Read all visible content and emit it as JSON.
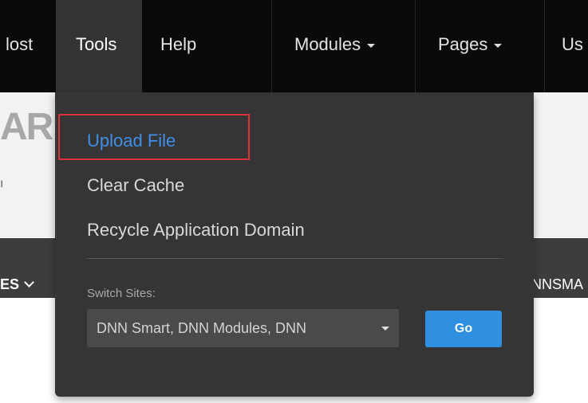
{
  "topbar": {
    "items": [
      {
        "label": "lost"
      },
      {
        "label": "Tools"
      },
      {
        "label": "Help"
      },
      {
        "label": "Modules"
      },
      {
        "label": "Pages"
      },
      {
        "label": "Us"
      }
    ]
  },
  "page": {
    "logo_fragment": "AR",
    "logo_sub_fragment": "ı",
    "menu_left": "ES",
    "menu_right": "NNSMA"
  },
  "tools_menu": {
    "items": [
      {
        "label": "Upload File",
        "active": true
      },
      {
        "label": "Clear Cache"
      },
      {
        "label": "Recycle Application Domain"
      }
    ],
    "switch_sites_label": "Switch Sites:",
    "site_select_value": "DNN Smart, DNN Modules, DNN",
    "go_label": "Go"
  },
  "colors": {
    "active_item": "#3f8ee8",
    "highlight_border": "#d8323a",
    "go_button": "#2f8fe0"
  }
}
